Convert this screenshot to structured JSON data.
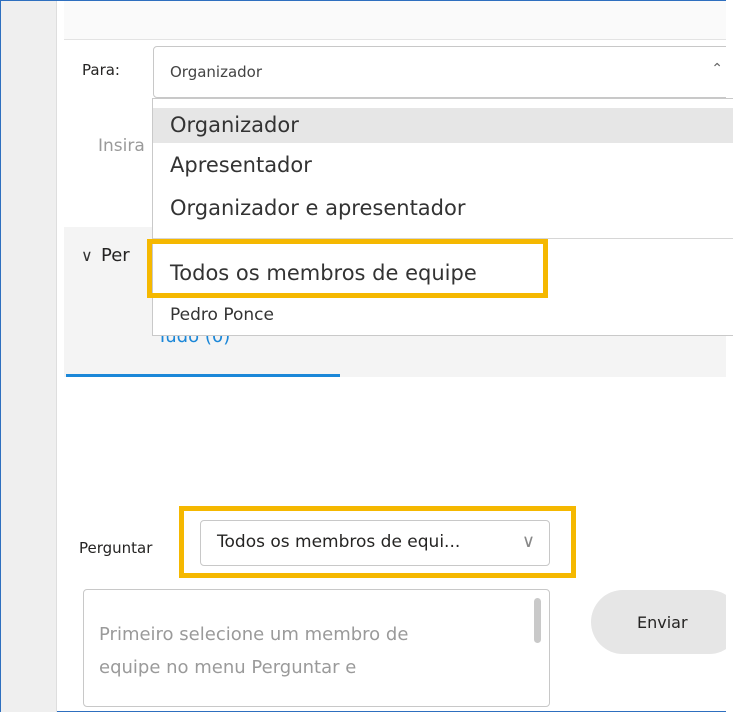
{
  "para": {
    "label": "Para:",
    "value": "Organizador",
    "options": [
      "Organizador",
      "Apresentador",
      "Organizador e apresentador",
      "Todos os membros de equipe",
      "Pedro Ponce"
    ],
    "selected_index": 0
  },
  "input_placeholder_partial": "Insira",
  "participants": {
    "section_label_partial": "Per",
    "tab_label": "Tudo (0)"
  },
  "perguntar": {
    "label": "Perguntar",
    "value": "Todos os membros de equi..."
  },
  "question": {
    "placeholder_line1": "Primeiro selecione um membro de",
    "placeholder_line2": "equipe no menu Perguntar e"
  },
  "send_button": "Enviar",
  "icons": {
    "para_chevron": "chevron-up-icon",
    "section_chevron": "chevron-down-icon",
    "perguntar_chevron": "chevron-down-icon"
  },
  "colors": {
    "highlight": "#f5b800",
    "accent": "#1b87d8",
    "frame_border": "#2e6fbf"
  }
}
